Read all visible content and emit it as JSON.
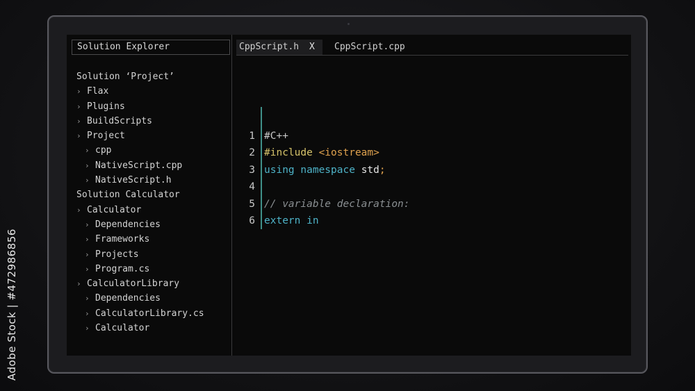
{
  "sidebar": {
    "title": "Solution Explorer",
    "items": [
      {
        "label": "Solution ‘Project’",
        "level": 0,
        "chevron": false
      },
      {
        "label": "Flax",
        "level": 1,
        "chevron": true
      },
      {
        "label": "Plugins",
        "level": 1,
        "chevron": true
      },
      {
        "label": "BuildScripts",
        "level": 1,
        "chevron": true
      },
      {
        "label": "Project",
        "level": 1,
        "chevron": true
      },
      {
        "label": "cpp",
        "level": 2,
        "chevron": true
      },
      {
        "label": "NativeScript.cpp",
        "level": 2,
        "chevron": true
      },
      {
        "label": "NativeScript.h",
        "level": 2,
        "chevron": true
      },
      {
        "label": "Solution Calculator",
        "level": 0,
        "chevron": false
      },
      {
        "label": "Calculator",
        "level": 1,
        "chevron": true
      },
      {
        "label": "Dependencies",
        "level": 2,
        "chevron": true
      },
      {
        "label": "Frameworks",
        "level": 2,
        "chevron": true
      },
      {
        "label": "Projects",
        "level": 2,
        "chevron": true
      },
      {
        "label": "Program.cs",
        "level": 2,
        "chevron": true
      },
      {
        "label": "CalculatorLibrary",
        "level": 1,
        "chevron": true
      },
      {
        "label": "Dependencies",
        "level": 2,
        "chevron": true
      },
      {
        "label": "CalculatorLibrary.cs",
        "level": 2,
        "chevron": true
      },
      {
        "label": "Calculator",
        "level": 2,
        "chevron": true
      }
    ]
  },
  "tabs": {
    "active": {
      "label": "CppScript.h",
      "close": "X"
    },
    "second": {
      "label": "CppScript.cpp"
    }
  },
  "code": {
    "lines": [
      {
        "num": "1",
        "parts": [
          {
            "text": "#C++",
            "kind": "hash"
          }
        ]
      },
      {
        "num": "2",
        "parts": [
          {
            "text": "#include ",
            "kind": "directive"
          },
          {
            "text": "<iostream>",
            "kind": "header"
          }
        ]
      },
      {
        "num": "3",
        "parts": [
          {
            "text": "using namespace ",
            "kind": "keyword"
          },
          {
            "text": "std",
            "kind": "plain"
          },
          {
            "text": ";",
            "kind": "punct"
          }
        ]
      },
      {
        "num": "4",
        "parts": []
      },
      {
        "num": "5",
        "parts": [
          {
            "text": "// variable declaration:",
            "kind": "comment"
          }
        ]
      },
      {
        "num": "6",
        "parts": [
          {
            "text": "extern in",
            "kind": "keyword"
          }
        ]
      }
    ]
  },
  "side_id": "Adobe Stock | #472986856",
  "colors": {
    "keyword": "#4eb3c8",
    "directive": "#d6c36a",
    "header": "#e0a24e",
    "comment": "#8a8f92",
    "gutter_accent": "#3f8f88"
  }
}
